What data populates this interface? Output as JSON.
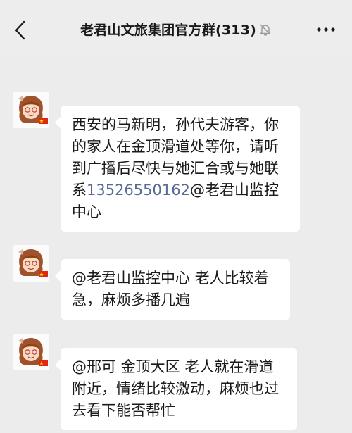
{
  "header": {
    "title": "老君山文旅集团官方群(313)",
    "back_icon": "chevron-left-icon",
    "mute_icon": "bell-muted-icon",
    "more_icon": "more-dots-icon"
  },
  "messages": [
    {
      "avatar": "cartoon-girl-avatar",
      "text_before": "西安的马新明，孙代夫游客，你的家人在金顶滑道处等你，请听到广播后尽快与她汇合或与她联系",
      "phone": "13526550162",
      "text_after": "@老君山监控中心"
    },
    {
      "avatar": "cartoon-girl-avatar",
      "text": "@老君山监控中心 老人比较着急，麻烦多播几遍"
    },
    {
      "avatar": "cartoon-girl-avatar",
      "text": "@邢可  金顶大区 老人就在滑道附近，情绪比较激动，麻烦也过去看下能否帮忙"
    }
  ],
  "colors": {
    "background": "#ececec",
    "bubble": "#ffffff",
    "link": "#576b95"
  }
}
